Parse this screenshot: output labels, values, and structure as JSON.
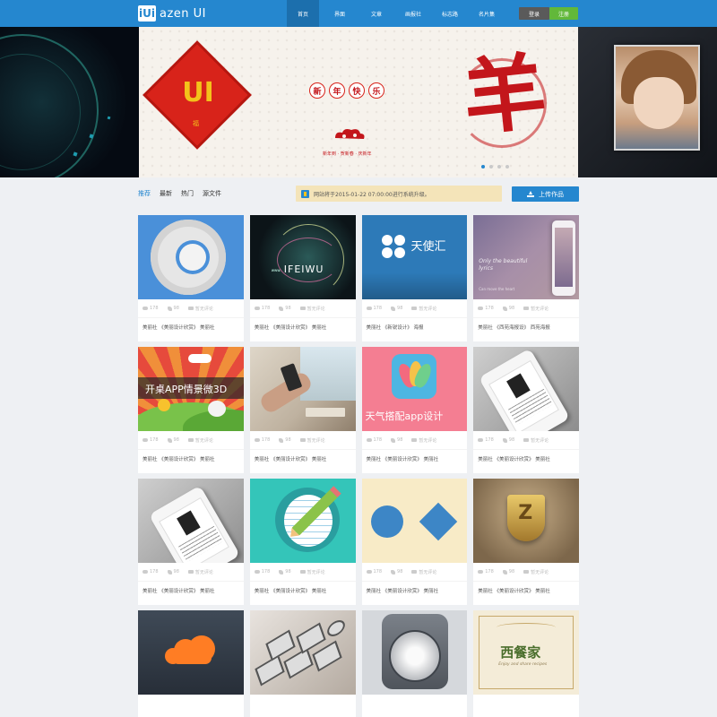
{
  "header": {
    "logo_mark": "iUi",
    "logo_text": "azen UI",
    "nav": [
      "首页",
      "界面",
      "文章",
      "画报社",
      "标志路",
      "名片集"
    ],
    "login": "登录",
    "register": "注册",
    "accent": "#2587cf"
  },
  "banner": {
    "diamond_text": "UI",
    "diamond_sub": "福",
    "greeting": [
      "新",
      "年",
      "快",
      "乐"
    ],
    "tagline": "新年到 · 贺新春 · 庆新年",
    "big_char": "羊",
    "slides": 4,
    "active_slide": 1
  },
  "toolbar": {
    "tabs": [
      "推荐",
      "最新",
      "热门",
      "源文件"
    ],
    "active_tab": 0,
    "notice": "网站将于2015-01-22 07:00:00进行系统升级。",
    "upload": "上传作品"
  },
  "cards": [
    {
      "thumb": "toggle",
      "views": "178",
      "likes": "98",
      "comments": "暂无评论",
      "tags": "美丽社 《美丽设计欣赏》 美丽社"
    },
    {
      "thumb": "feiwu",
      "thumb_text": "IFEIWU",
      "thumb_sub": "www.",
      "views": "178",
      "likes": "98",
      "comments": "暂无评论",
      "tags": "美丽社 《美丽设计欣赏》 美丽社"
    },
    {
      "thumb": "angel",
      "thumb_text": "天使汇",
      "views": "178",
      "likes": "98",
      "comments": "暂无评论",
      "tags": "美丽社 《新锐设计》 海报"
    },
    {
      "thumb": "lyrics",
      "thumb_text": "Only the beautiful lyrics",
      "thumb_sub": "Can move the heart",
      "views": "178",
      "likes": "98",
      "comments": "暂无评论",
      "tags": "美丽社 《西苑海报设》 西苑海报"
    },
    {
      "thumb": "desktop",
      "thumb_text": "开桌APP情景微3D",
      "views": "178",
      "likes": "98",
      "comments": "暂无评论",
      "tags": "美丽社 《美丽设计欣赏》 美丽社"
    },
    {
      "thumb": "hand",
      "views": "178",
      "likes": "98",
      "comments": "暂无评论",
      "tags": "美丽社 《美丽设计欣赏》 美丽社"
    },
    {
      "thumb": "weather",
      "thumb_text": "天气搭配app设计",
      "views": "178",
      "likes": "98",
      "comments": "暂无评论",
      "tags": "美丽社 《美丽设计欣赏》 美丽社"
    },
    {
      "thumb": "iphone",
      "views": "178",
      "likes": "98",
      "comments": "暂无评论",
      "tags": "美丽社 《美丽设计欣赏》 美丽社"
    },
    {
      "thumb": "iphone",
      "views": "178",
      "likes": "98",
      "comments": "暂无评论",
      "tags": "美丽社 《美丽设计欣赏》 美丽社"
    },
    {
      "thumb": "pencil",
      "views": "178",
      "likes": "98",
      "comments": "暂无评论",
      "tags": "美丽社 《美丽设计欣赏》 美丽社"
    },
    {
      "thumb": "shapes",
      "views": "178",
      "likes": "98",
      "comments": "暂无评论",
      "tags": "美丽社 《美丽设计欣赏》 美丽社"
    },
    {
      "thumb": "badge",
      "thumb_text": "Z",
      "views": "178",
      "likes": "98",
      "comments": "暂无评论",
      "tags": "美丽社 《美丽设计欣赏》 美丽社"
    },
    {
      "thumb": "cloud"
    },
    {
      "thumb": "ui"
    },
    {
      "thumb": "safe"
    },
    {
      "thumb": "western",
      "thumb_text": "西餐家",
      "thumb_sub": "Enjoy and share recipes"
    }
  ]
}
